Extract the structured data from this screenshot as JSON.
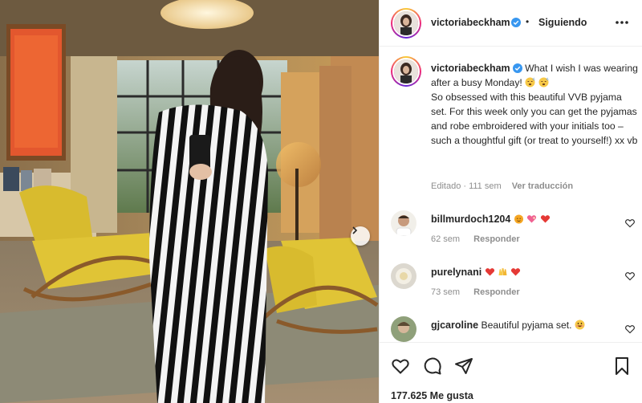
{
  "post": {
    "author": "victoriabeckham",
    "follow_status": "Siguiendo",
    "caption": "What I wish I was wearing after a busy Monday! ",
    "caption_rest": "So obsessed with this beautiful VVB pyjama set. For this week only you can get the pyjamas and robe embroidered with your initials too – such a thoughtful gift (or treat to yourself!) xx vb",
    "edited": "Editado · 111 sem",
    "translate_label": "Ver traducción",
    "likes": "177.625 Me gusta"
  },
  "comments": [
    {
      "user": "billmurdoch1204",
      "time": "62 sem",
      "reply": "Responder",
      "icons": [
        "smile-cat-emoji",
        "sparkle-heart-emoji",
        "red-heart-emoji"
      ]
    },
    {
      "user": "purelynani",
      "time": "73 sem",
      "reply": "Responder",
      "icons": [
        "red-heart-emoji",
        "raised-hands-emoji",
        "red-heart-emoji"
      ]
    },
    {
      "user": "gjcaroline",
      "text": "Beautiful pyjama set.",
      "icons": [
        "smiling-emoji"
      ]
    }
  ],
  "colors": {
    "verified": "#3897f0",
    "heart": "#ed4956",
    "text": "#262626",
    "muted": "#8e8e8e"
  }
}
